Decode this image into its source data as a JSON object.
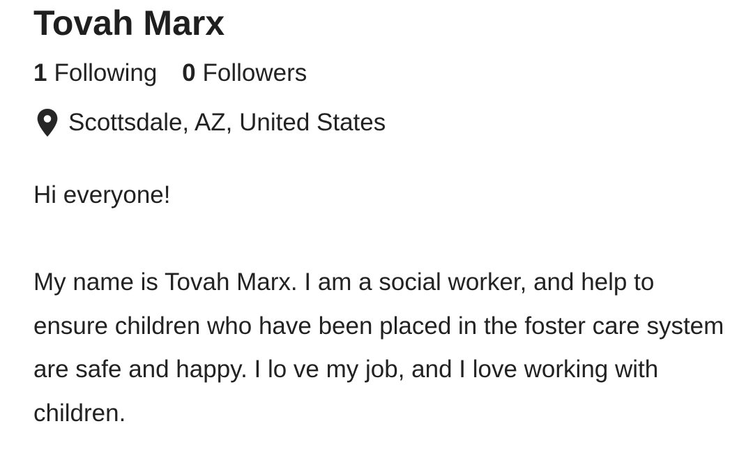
{
  "profile": {
    "name": "Tovah Marx",
    "following_count": "1",
    "following_label": "Following",
    "followers_count": "0",
    "followers_label": "Followers",
    "location_icon": "map-pin-icon",
    "location": "Scottsdale, AZ, United States",
    "bio": {
      "greeting": "Hi everyone!",
      "lines": [
        "My name is Tovah Marx. I am a social worker, and help to",
        "ensure children who have been placed in the foster care system",
        "are safe and happy. I lo ve my job, and I love working with",
        "children."
      ]
    }
  }
}
